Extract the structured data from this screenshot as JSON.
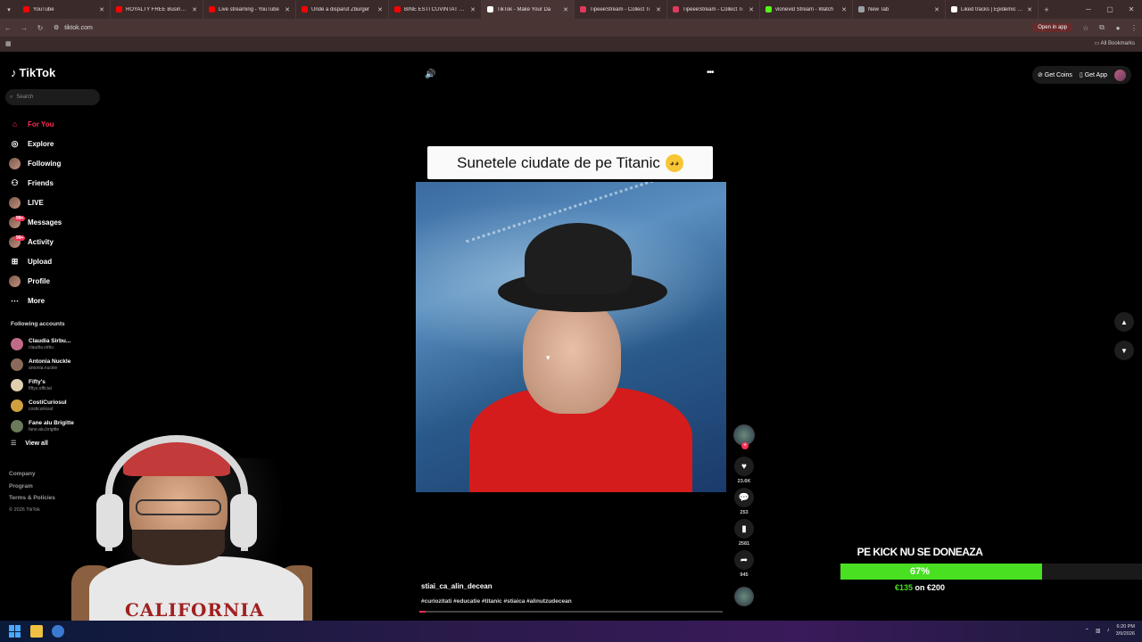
{
  "browser": {
    "tabs": [
      {
        "label": "YouTube",
        "color": "#ff0000"
      },
      {
        "label": "ROYALTY FREE Business M",
        "color": "#ff0000"
      },
      {
        "label": "Live streaming - YouTube",
        "color": "#ff0000"
      },
      {
        "label": "Unde a dispărut Zburger",
        "color": "#ff0000"
      },
      {
        "label": "BINE ESTI CUVINTAT DOI",
        "color": "#ff0000"
      },
      {
        "label": "TikTok - Make Your Da",
        "color": "#ffffff",
        "active": true
      },
      {
        "label": "TipeeeStream - Collect Ti",
        "color": "#e03a5a"
      },
      {
        "label": "TipeeeStream - Collect Ti",
        "color": "#e03a5a"
      },
      {
        "label": "vlonevid Stream - Watch",
        "color": "#53fc18"
      },
      {
        "label": "New Tab",
        "color": "#9aa0a6"
      },
      {
        "label": "Liked tracks | Epidemic So",
        "color": "#ffffff"
      }
    ],
    "url": "tiktok.com",
    "open_in_app": "Open in app",
    "all_bookmarks": "All Bookmarks"
  },
  "tiktok": {
    "logo": "TikTok",
    "search_placeholder": "Search",
    "nav": [
      {
        "label": "For You",
        "icon": "home-icon"
      },
      {
        "label": "Explore",
        "icon": "compass-icon"
      },
      {
        "label": "Following",
        "icon": "avatar-icon"
      },
      {
        "label": "Friends",
        "icon": "friends-icon"
      },
      {
        "label": "LIVE",
        "icon": "live-icon"
      },
      {
        "label": "Messages",
        "icon": "messages-icon",
        "badge": "99+"
      },
      {
        "label": "Activity",
        "icon": "activity-icon",
        "badge": "99+"
      },
      {
        "label": "Upload",
        "icon": "upload-icon"
      },
      {
        "label": "Profile",
        "icon": "profile-icon"
      },
      {
        "label": "More",
        "icon": "more-icon"
      }
    ],
    "following_header": "Following accounts",
    "accounts": [
      {
        "name": "Claudia Sirbu...",
        "handle": "claudia.sirbu",
        "color": "#c06a8a"
      },
      {
        "name": "Antonia Nuckle",
        "handle": "antonia.nuckle",
        "color": "#8a6a5a"
      },
      {
        "name": "Fifty's",
        "handle": "fiftys.official",
        "color": "#e0d0b0"
      },
      {
        "name": "CostiCuriosul",
        "handle": "costicuriosul",
        "color": "#d0a040"
      },
      {
        "name": "Fane alu Brigitte",
        "handle": "fane.alu.brigitte",
        "color": "#6a7a5a"
      }
    ],
    "view_all": "View all",
    "footer": [
      "Company",
      "Program",
      "Terms & Policies"
    ],
    "copyright": "© 2026 TikTok",
    "top_right": {
      "coins": "Get Coins",
      "app": "Get App"
    },
    "video": {
      "caption": "Sunetele ciudate de pe Titanic",
      "author": "stiai_ca_alin_decean",
      "tags": "#curiozitati #educatie #titanic #stiaica #alinutzudecean",
      "progress": 0.02,
      "likes": "23.6K",
      "comments": "253",
      "saves": "2581",
      "shares": "945"
    }
  },
  "overlay": {
    "donation_title": "PE KICK NU SE DONEAZA",
    "donation_pct": "67%",
    "donation_fill": 0.67,
    "donation_raised": "€135",
    "donation_goal_text": "on €200",
    "shirt_text": "CALIFORNIA"
  },
  "taskbar": {
    "time": "6:20 PM",
    "date": "3/9/2026"
  }
}
